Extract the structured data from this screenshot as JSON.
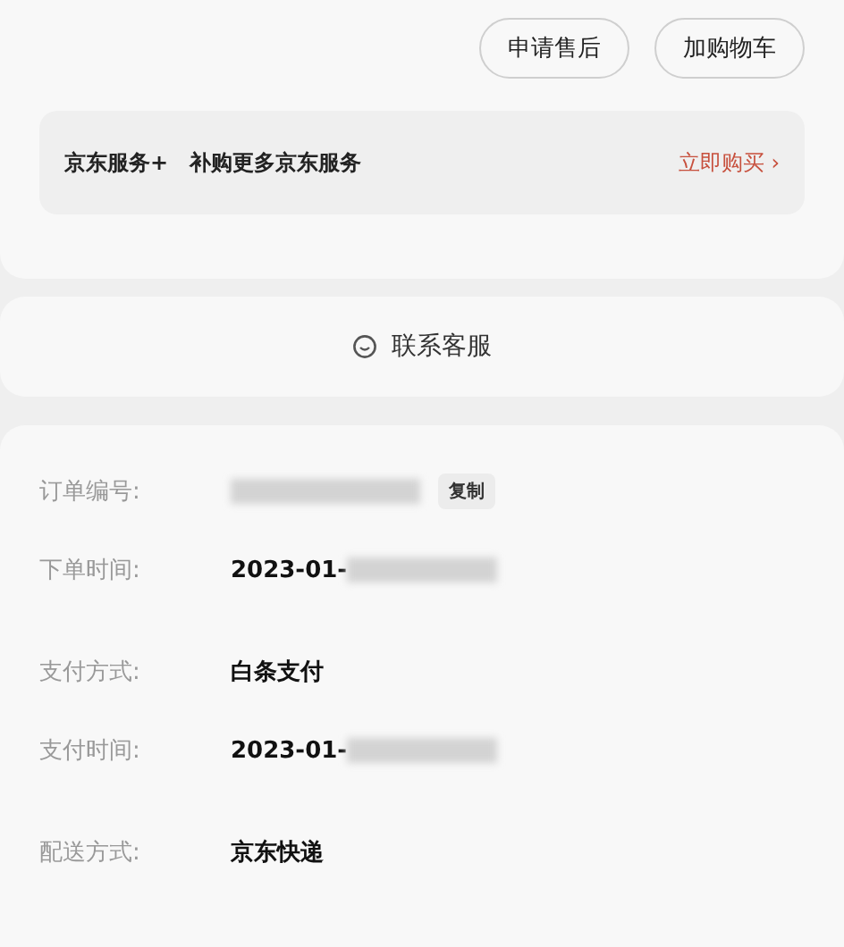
{
  "actions": [
    {
      "label": "申请售后"
    },
    {
      "label": "加购物车"
    }
  ],
  "service_banner": {
    "title": "京东服务+",
    "subtitle": "补购更多京东服务",
    "link": "立即购买",
    "arrow": "›"
  },
  "contact": {
    "label": "联系客服"
  },
  "order_info": [
    {
      "rows": [
        {
          "label": "订单编号:",
          "redacted": true,
          "copy": "复制"
        },
        {
          "label": "下单时间:",
          "value": "2023-01-",
          "redacted": true
        }
      ]
    },
    {
      "rows": [
        {
          "label": "支付方式:",
          "value": "白条支付",
          "redacted": false
        },
        {
          "label": "支付时间:",
          "value": "2023-01-",
          "redacted": true
        }
      ]
    },
    {
      "rows": [
        {
          "label": "配送方式:",
          "value": "京东快递",
          "redacted": false
        }
      ]
    }
  ]
}
